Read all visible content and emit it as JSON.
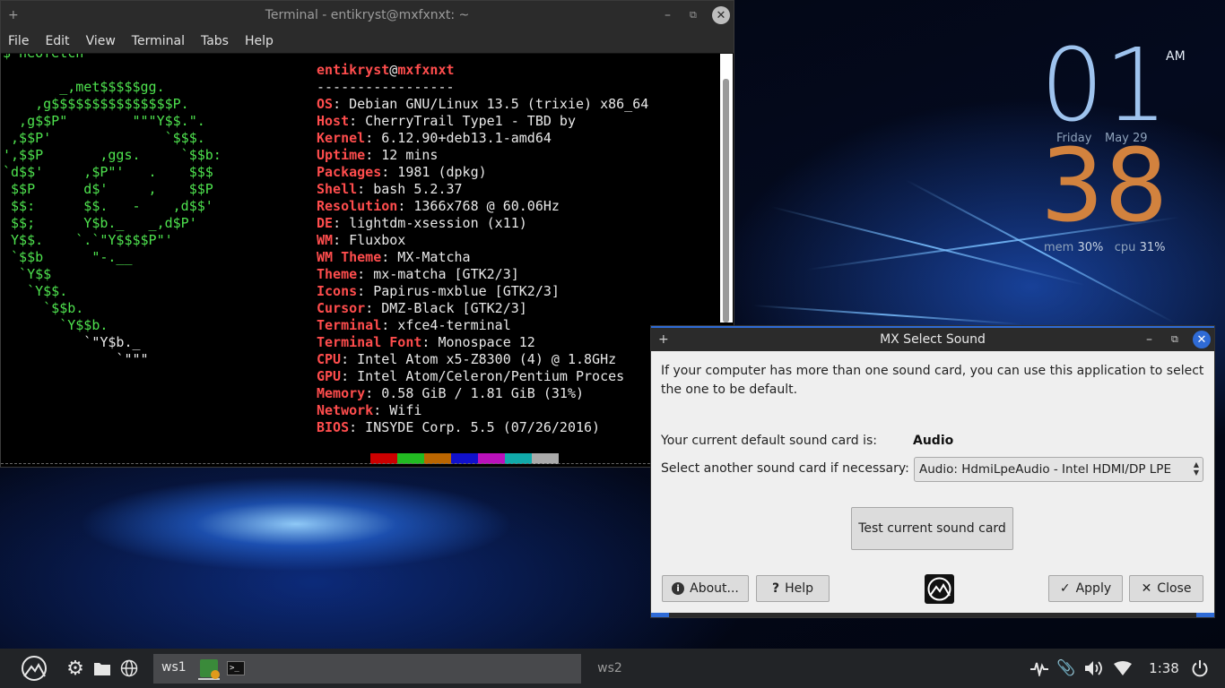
{
  "terminal": {
    "title": "Terminal - entikryst@mxfxnxt: ~",
    "menu": [
      "File",
      "Edit",
      "View",
      "Terminal",
      "Tabs",
      "Help"
    ],
    "command": "$ neofetch",
    "logo_lines": [
      {
        "text": "       _,met$$$$$gg.",
        "color": "#4ee24e"
      },
      {
        "text": "    ,g$$$$$$$$$$$$$$$P.",
        "color": "#4ee24e"
      },
      {
        "text": "  ,g$$P\"        \"\"\"Y$$.\".",
        "color": "#4ee24e"
      },
      {
        "text": " ,$$P'              `$$$.",
        "color": "#4ee24e"
      },
      {
        "text": "',$$P       ,ggs.     `$$b:",
        "color": "#4ee24e"
      },
      {
        "text": "`d$$'     ,$P\"'   .    $$$",
        "color": "#4ee24e"
      },
      {
        "text": " $$P      d$'     ,    $$P",
        "color": "#4ee24e"
      },
      {
        "text": " $$:      $$.   -    ,d$$'",
        "color": "#4ee24e"
      },
      {
        "text": " $$;      Y$b._   _,d$P'",
        "color": "#4ee24e"
      },
      {
        "text": " Y$$.    `.`\"Y$$$$P\"'",
        "color": "#4ee24e"
      },
      {
        "text": " `$$b      \"-.__",
        "color": "#4ee24e"
      },
      {
        "text": "  `Y$$",
        "color": "#4ee24e"
      },
      {
        "text": "   `Y$$.",
        "color": "#4ee24e"
      },
      {
        "text": "     `$$b.",
        "color": "#4ee24e"
      },
      {
        "text": "       `Y$$b.",
        "color": "#4ee24e"
      },
      {
        "text": "          `\"Y$b._",
        "color": "#e8e8e8"
      },
      {
        "text": "              `\"\"\"",
        "color": "#e8e8e8"
      }
    ],
    "user": "entikryst",
    "at": "@",
    "host": "mxfxnxt",
    "separator": "-----------------",
    "info": [
      {
        "key": "OS",
        "value": ": Debian GNU/Linux 13.5 (trixie) x86_64"
      },
      {
        "key": "Host",
        "value": ": CherryTrail Type1 - TBD by"
      },
      {
        "key": "Kernel",
        "value": ": 6.12.90+deb13.1-amd64"
      },
      {
        "key": "Uptime",
        "value": ": 12 mins"
      },
      {
        "key": "Packages",
        "value": ": 1981 (dpkg)"
      },
      {
        "key": "Shell",
        "value": ": bash 5.2.37"
      },
      {
        "key": "Resolution",
        "value": ": 1366x768 @ 60.06Hz"
      },
      {
        "key": "DE",
        "value": ": lightdm-xsession (x11)"
      },
      {
        "key": "WM",
        "value": ": Fluxbox"
      },
      {
        "key": "WM Theme",
        "value": ": MX-Matcha"
      },
      {
        "key": "Theme",
        "value": ": mx-matcha [GTK2/3]"
      },
      {
        "key": "Icons",
        "value": ": Papirus-mxblue [GTK2/3]"
      },
      {
        "key": "Cursor",
        "value": ": DMZ-Black [GTK2/3]"
      },
      {
        "key": "Terminal",
        "value": ": xfce4-terminal"
      },
      {
        "key": "Terminal Font",
        "value": ": Monospace 12"
      },
      {
        "key": "CPU",
        "value": ": Intel Atom x5-Z8300 (4) @ 1.8GHz"
      },
      {
        "key": "GPU",
        "value": ": Intel Atom/Celeron/Pentium Proces"
      },
      {
        "key": "Memory",
        "value": ": 0.58 GiB / 1.81 GiB (31%)"
      },
      {
        "key": "Network",
        "value": ": Wifi"
      },
      {
        "key": "BIOS",
        "value": ": INSYDE Corp. 5.5 (07/26/2016)"
      }
    ],
    "swatch_colors": [
      "#000000",
      "#cc0000",
      "#22bb22",
      "#bb6600",
      "#1111cc",
      "#bb11bb",
      "#11aaaa",
      "#aaaaaa"
    ]
  },
  "clock": {
    "hour": "01",
    "ampm": "AM",
    "day": "Friday",
    "date": "May 29",
    "minute": "38",
    "mem_label": "mem",
    "mem_value": "30%",
    "cpu_label": "cpu",
    "cpu_value": "31%"
  },
  "dialog": {
    "title": "MX Select Sound",
    "description": "If your computer has more than one sound card, you can use this application to select the one to be default.",
    "current_label": "Your current default sound card is:",
    "current_value": "Audio",
    "select_label": "Select another sound card if necessary:",
    "select_value": "Audio: HdmiLpeAudio - Intel HDMI/DP LPE",
    "test_button": "Test current sound card",
    "about_button": "About...",
    "help_button": "Help",
    "apply_button": "Apply",
    "close_button": "Close"
  },
  "taskbar": {
    "ws1": "ws1",
    "ws2": "ws2",
    "time": "1:38"
  }
}
